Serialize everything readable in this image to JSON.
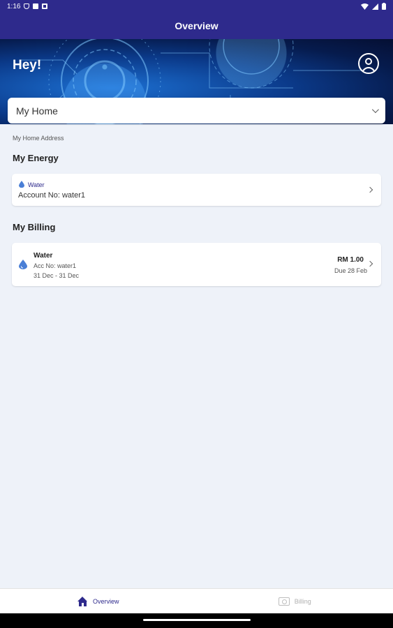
{
  "status_bar": {
    "time": "1:16"
  },
  "app_bar": {
    "title": "Overview"
  },
  "hero": {
    "greeting": "Hey!"
  },
  "home_selector": {
    "value": "My Home"
  },
  "address_label": "My Home Address",
  "my_energy": {
    "title": "My Energy",
    "card": {
      "type": "Water",
      "account": "Account No: water1"
    }
  },
  "my_billing": {
    "title": "My Billing",
    "card": {
      "title": "Water",
      "account": "Acc No: water1",
      "period": "31 Dec - 31 Dec",
      "amount": "RM 1.00",
      "due": "Due 28 Feb"
    }
  },
  "bottom_nav": {
    "items": [
      {
        "label": "Overview",
        "active": true
      },
      {
        "label": "Billing",
        "active": false
      }
    ]
  },
  "colors": {
    "primary": "#2e2a8c",
    "water_blue": "#4a7fd6",
    "background": "#eef2f9"
  },
  "icons": [
    "wifi-icon",
    "signal-icon",
    "battery-icon",
    "profile-icon",
    "chevron-down-icon",
    "water-drop-icon",
    "chevron-right-icon",
    "home-icon",
    "billing-icon"
  ]
}
